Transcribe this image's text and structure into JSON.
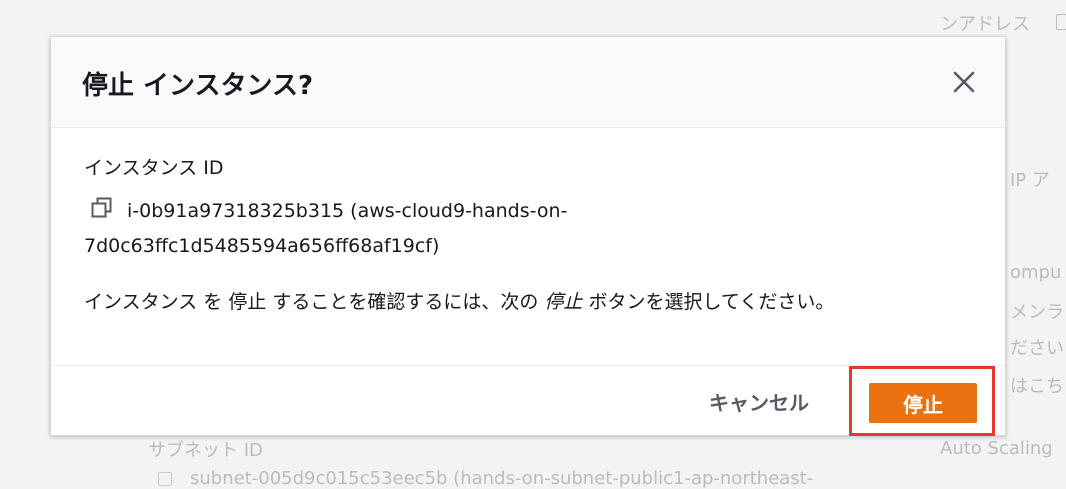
{
  "background": {
    "top_right_label": "ンアドレス",
    "mid_right_label_1": "IP ア",
    "mid_right_label_2": "ompu",
    "mid_right_label_3": "メンラ",
    "mid_right_label_4": "ださい",
    "mid_right_label_5": "はこち",
    "subnet_label": "サブネット ID",
    "subnet_value": "subnet-005d9c015c53eec5b (hands-on-subnet-public1-ap-northeast-",
    "auto_scaling_label": "Auto Scaling"
  },
  "dialog": {
    "title": "停止 インスタンス?",
    "close_label": "×",
    "instance_id_label": "インスタンス ID",
    "instance_id_value": "i-0b91a97318325b315 (aws-cloud9-hands-on-7d0c63ffc1d5485594a656ff68af19cf)",
    "confirm_prefix": "インスタンス を 停止 することを確認するには、次の ",
    "confirm_emphasis": "停止",
    "confirm_suffix": " ボタンを選択してください。",
    "cancel_label": "キャンセル",
    "stop_label": "停止"
  },
  "colors": {
    "primary_button": "#ec7211",
    "highlight": "#e8382b"
  }
}
